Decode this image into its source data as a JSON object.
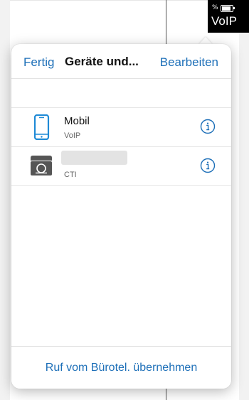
{
  "status_bar": {
    "percent": "%",
    "label": "VoIP",
    "battery_level": 0.85
  },
  "popover": {
    "nav": {
      "left_label": "Fertig",
      "title": "Geräte und...",
      "right_label": "Bearbeiten"
    },
    "devices": [
      {
        "name": "Mobil",
        "type": "VoIP",
        "icon": "mobile-phone-icon"
      },
      {
        "name": "",
        "type": "CTI",
        "icon": "desk-phone-icon"
      }
    ],
    "footer_action": "Ruf vom Bürotel. übernehmen"
  },
  "colors": {
    "accent": "#1d6fb8",
    "mobile_icon": "#1e8ad6",
    "desk_icon": "#555555"
  }
}
